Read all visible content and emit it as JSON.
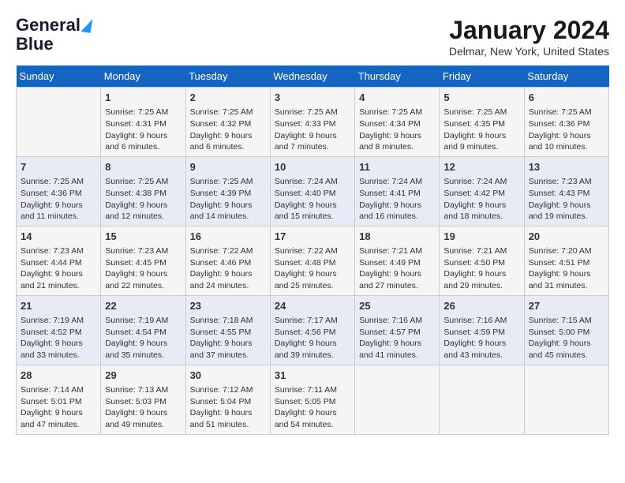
{
  "logo": {
    "line1": "General",
    "line2": "Blue"
  },
  "title": "January 2024",
  "location": "Delmar, New York, United States",
  "headers": [
    "Sunday",
    "Monday",
    "Tuesday",
    "Wednesday",
    "Thursday",
    "Friday",
    "Saturday"
  ],
  "weeks": [
    [
      {
        "day": "",
        "content": ""
      },
      {
        "day": "1",
        "content": "Sunrise: 7:25 AM\nSunset: 4:31 PM\nDaylight: 9 hours\nand 6 minutes."
      },
      {
        "day": "2",
        "content": "Sunrise: 7:25 AM\nSunset: 4:32 PM\nDaylight: 9 hours\nand 6 minutes."
      },
      {
        "day": "3",
        "content": "Sunrise: 7:25 AM\nSunset: 4:33 PM\nDaylight: 9 hours\nand 7 minutes."
      },
      {
        "day": "4",
        "content": "Sunrise: 7:25 AM\nSunset: 4:34 PM\nDaylight: 9 hours\nand 8 minutes."
      },
      {
        "day": "5",
        "content": "Sunrise: 7:25 AM\nSunset: 4:35 PM\nDaylight: 9 hours\nand 9 minutes."
      },
      {
        "day": "6",
        "content": "Sunrise: 7:25 AM\nSunset: 4:36 PM\nDaylight: 9 hours\nand 10 minutes."
      }
    ],
    [
      {
        "day": "7",
        "content": "Sunrise: 7:25 AM\nSunset: 4:36 PM\nDaylight: 9 hours\nand 11 minutes."
      },
      {
        "day": "8",
        "content": "Sunrise: 7:25 AM\nSunset: 4:38 PM\nDaylight: 9 hours\nand 12 minutes."
      },
      {
        "day": "9",
        "content": "Sunrise: 7:25 AM\nSunset: 4:39 PM\nDaylight: 9 hours\nand 14 minutes."
      },
      {
        "day": "10",
        "content": "Sunrise: 7:24 AM\nSunset: 4:40 PM\nDaylight: 9 hours\nand 15 minutes."
      },
      {
        "day": "11",
        "content": "Sunrise: 7:24 AM\nSunset: 4:41 PM\nDaylight: 9 hours\nand 16 minutes."
      },
      {
        "day": "12",
        "content": "Sunrise: 7:24 AM\nSunset: 4:42 PM\nDaylight: 9 hours\nand 18 minutes."
      },
      {
        "day": "13",
        "content": "Sunrise: 7:23 AM\nSunset: 4:43 PM\nDaylight: 9 hours\nand 19 minutes."
      }
    ],
    [
      {
        "day": "14",
        "content": "Sunrise: 7:23 AM\nSunset: 4:44 PM\nDaylight: 9 hours\nand 21 minutes."
      },
      {
        "day": "15",
        "content": "Sunrise: 7:23 AM\nSunset: 4:45 PM\nDaylight: 9 hours\nand 22 minutes."
      },
      {
        "day": "16",
        "content": "Sunrise: 7:22 AM\nSunset: 4:46 PM\nDaylight: 9 hours\nand 24 minutes."
      },
      {
        "day": "17",
        "content": "Sunrise: 7:22 AM\nSunset: 4:48 PM\nDaylight: 9 hours\nand 25 minutes."
      },
      {
        "day": "18",
        "content": "Sunrise: 7:21 AM\nSunset: 4:49 PM\nDaylight: 9 hours\nand 27 minutes."
      },
      {
        "day": "19",
        "content": "Sunrise: 7:21 AM\nSunset: 4:50 PM\nDaylight: 9 hours\nand 29 minutes."
      },
      {
        "day": "20",
        "content": "Sunrise: 7:20 AM\nSunset: 4:51 PM\nDaylight: 9 hours\nand 31 minutes."
      }
    ],
    [
      {
        "day": "21",
        "content": "Sunrise: 7:19 AM\nSunset: 4:52 PM\nDaylight: 9 hours\nand 33 minutes."
      },
      {
        "day": "22",
        "content": "Sunrise: 7:19 AM\nSunset: 4:54 PM\nDaylight: 9 hours\nand 35 minutes."
      },
      {
        "day": "23",
        "content": "Sunrise: 7:18 AM\nSunset: 4:55 PM\nDaylight: 9 hours\nand 37 minutes."
      },
      {
        "day": "24",
        "content": "Sunrise: 7:17 AM\nSunset: 4:56 PM\nDaylight: 9 hours\nand 39 minutes."
      },
      {
        "day": "25",
        "content": "Sunrise: 7:16 AM\nSunset: 4:57 PM\nDaylight: 9 hours\nand 41 minutes."
      },
      {
        "day": "26",
        "content": "Sunrise: 7:16 AM\nSunset: 4:59 PM\nDaylight: 9 hours\nand 43 minutes."
      },
      {
        "day": "27",
        "content": "Sunrise: 7:15 AM\nSunset: 5:00 PM\nDaylight: 9 hours\nand 45 minutes."
      }
    ],
    [
      {
        "day": "28",
        "content": "Sunrise: 7:14 AM\nSunset: 5:01 PM\nDaylight: 9 hours\nand 47 minutes."
      },
      {
        "day": "29",
        "content": "Sunrise: 7:13 AM\nSunset: 5:03 PM\nDaylight: 9 hours\nand 49 minutes."
      },
      {
        "day": "30",
        "content": "Sunrise: 7:12 AM\nSunset: 5:04 PM\nDaylight: 9 hours\nand 51 minutes."
      },
      {
        "day": "31",
        "content": "Sunrise: 7:11 AM\nSunset: 5:05 PM\nDaylight: 9 hours\nand 54 minutes."
      },
      {
        "day": "",
        "content": ""
      },
      {
        "day": "",
        "content": ""
      },
      {
        "day": "",
        "content": ""
      }
    ]
  ]
}
